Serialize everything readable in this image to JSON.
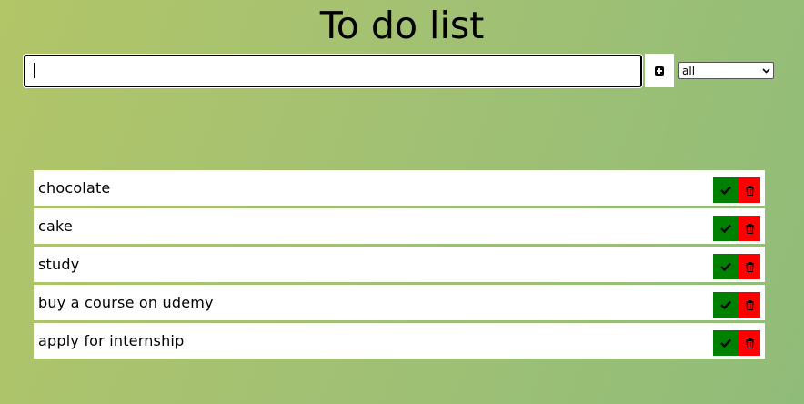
{
  "header": {
    "title": "To do list"
  },
  "form": {
    "input_value": "",
    "add_icon": "plus-square-icon",
    "filter": {
      "selected": "all"
    }
  },
  "todos": [
    {
      "text": "chocolate"
    },
    {
      "text": "cake"
    },
    {
      "text": "study"
    },
    {
      "text": "buy a course on udemy"
    },
    {
      "text": "apply for internship"
    }
  ],
  "colors": {
    "complete_button": "#008000",
    "delete_button": "#ff0000",
    "background_start": "#b2c567",
    "background_end": "#90bc79"
  },
  "icons": {
    "complete": "check-icon",
    "delete": "trash-icon"
  }
}
